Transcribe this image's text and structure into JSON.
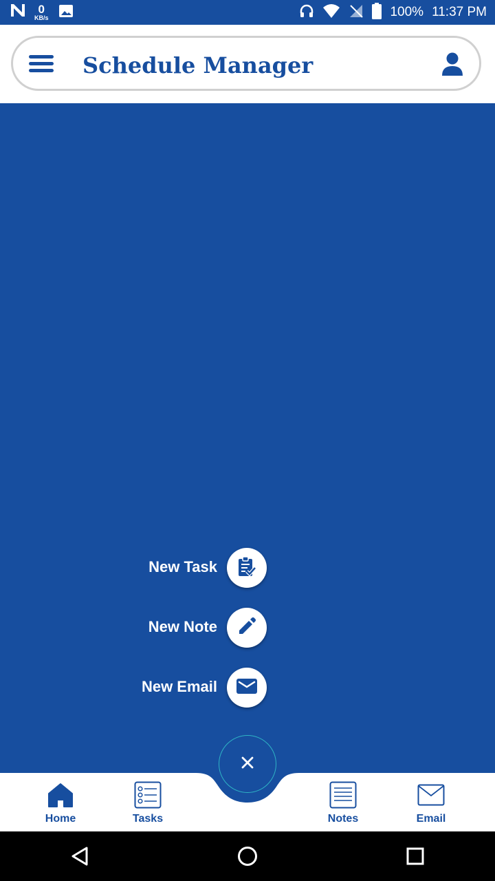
{
  "status_bar": {
    "carrier_icon": "n-logo-icon",
    "network_speed_value": "0",
    "network_speed_unit": "KB/s",
    "battery": "100%",
    "time": "11:37 PM"
  },
  "header": {
    "title": "Schedule Manager",
    "menu_icon": "hamburger-menu-icon",
    "profile_icon": "person-icon"
  },
  "speed_dial": [
    {
      "label": "New Task",
      "icon": "clipboard-check-icon"
    },
    {
      "label": "New Note",
      "icon": "pencil-icon"
    },
    {
      "label": "New Email",
      "icon": "envelope-icon"
    }
  ],
  "fab": {
    "icon": "close-icon"
  },
  "bottom_nav": [
    {
      "label": "Home",
      "icon": "home-icon"
    },
    {
      "label": "Tasks",
      "icon": "checklist-icon"
    },
    {
      "label": "Notes",
      "icon": "notes-icon"
    },
    {
      "label": "Email",
      "icon": "envelope-outline-icon"
    }
  ],
  "colors": {
    "primary": "#174E9F",
    "background": "#FFFFFF",
    "fab_border": "#2FB4C5"
  }
}
